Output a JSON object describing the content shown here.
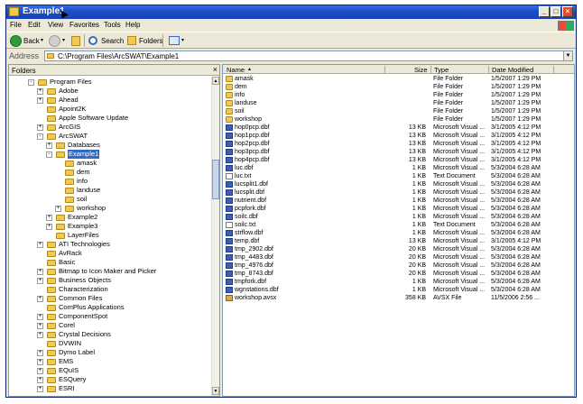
{
  "window": {
    "title": "Example1"
  },
  "menu": [
    "File",
    "Edit",
    "View",
    "Favorites",
    "Tools",
    "Help"
  ],
  "toolbar": {
    "back": "Back",
    "search": "Search",
    "folders": "Folders"
  },
  "address": {
    "label": "Address",
    "value": "C:\\Program Files\\ArcSWAT\\Example1"
  },
  "folders_pane": {
    "title": "Folders"
  },
  "tree": [
    {
      "label": "Program Files",
      "indent": 0,
      "toggle": "-"
    },
    {
      "label": "Adobe",
      "indent": 1,
      "toggle": "+"
    },
    {
      "label": "Ahead",
      "indent": 1,
      "toggle": "+"
    },
    {
      "label": "Apoint2K",
      "indent": 1,
      "toggle": ""
    },
    {
      "label": "Apple Software Update",
      "indent": 1,
      "toggle": ""
    },
    {
      "label": "ArcGIS",
      "indent": 1,
      "toggle": "+"
    },
    {
      "label": "ArcSWAT",
      "indent": 1,
      "toggle": "-"
    },
    {
      "label": "Databases",
      "indent": 2,
      "toggle": "+"
    },
    {
      "label": "Example1",
      "indent": 2,
      "toggle": "-",
      "selected": true
    },
    {
      "label": "amask",
      "indent": 3,
      "toggle": ""
    },
    {
      "label": "dem",
      "indent": 3,
      "toggle": ""
    },
    {
      "label": "info",
      "indent": 3,
      "toggle": ""
    },
    {
      "label": "landuse",
      "indent": 3,
      "toggle": ""
    },
    {
      "label": "soil",
      "indent": 3,
      "toggle": ""
    },
    {
      "label": "workshop",
      "indent": 3,
      "toggle": "+"
    },
    {
      "label": "Example2",
      "indent": 2,
      "toggle": "+"
    },
    {
      "label": "Example3",
      "indent": 2,
      "toggle": "+"
    },
    {
      "label": "LayerFiles",
      "indent": 2,
      "toggle": ""
    },
    {
      "label": "ATI Technologies",
      "indent": 1,
      "toggle": "+"
    },
    {
      "label": "AvRack",
      "indent": 1,
      "toggle": ""
    },
    {
      "label": "Basic",
      "indent": 1,
      "toggle": ""
    },
    {
      "label": "Bitmap to Icon Maker and Picker",
      "indent": 1,
      "toggle": "+"
    },
    {
      "label": "Business Objects",
      "indent": 1,
      "toggle": "+"
    },
    {
      "label": "Characterization",
      "indent": 1,
      "toggle": ""
    },
    {
      "label": "Common Files",
      "indent": 1,
      "toggle": "+"
    },
    {
      "label": "ComPlus Applications",
      "indent": 1,
      "toggle": ""
    },
    {
      "label": "ComponentSpot",
      "indent": 1,
      "toggle": "+"
    },
    {
      "label": "Corel",
      "indent": 1,
      "toggle": "+"
    },
    {
      "label": "Crystal Decisions",
      "indent": 1,
      "toggle": "+"
    },
    {
      "label": "DVWIN",
      "indent": 1,
      "toggle": ""
    },
    {
      "label": "Dymo Label",
      "indent": 1,
      "toggle": "+"
    },
    {
      "label": "EMS",
      "indent": 1,
      "toggle": "+"
    },
    {
      "label": "EQuIS",
      "indent": 1,
      "toggle": "+"
    },
    {
      "label": "ESQuery",
      "indent": 1,
      "toggle": "+"
    },
    {
      "label": "ESRI",
      "indent": 1,
      "toggle": "+"
    }
  ],
  "columns": {
    "name": "Name",
    "size": "Size",
    "type": "Type",
    "date": "Date Modified"
  },
  "files": [
    {
      "name": "amask",
      "size": "",
      "type": "File Folder",
      "date": "1/5/2007 1:29 PM",
      "icon": "folder"
    },
    {
      "name": "dem",
      "size": "",
      "type": "File Folder",
      "date": "1/5/2007 1:29 PM",
      "icon": "folder"
    },
    {
      "name": "info",
      "size": "",
      "type": "File Folder",
      "date": "1/5/2007 1:29 PM",
      "icon": "folder"
    },
    {
      "name": "landuse",
      "size": "",
      "type": "File Folder",
      "date": "1/5/2007 1:29 PM",
      "icon": "folder"
    },
    {
      "name": "soil",
      "size": "",
      "type": "File Folder",
      "date": "1/5/2007 1:29 PM",
      "icon": "folder"
    },
    {
      "name": "workshop",
      "size": "",
      "type": "File Folder",
      "date": "1/5/2007 1:29 PM",
      "icon": "folder"
    },
    {
      "name": "hop0pcp.dbf",
      "size": "13 KB",
      "type": "Microsoft Visual ...",
      "date": "3/1/2005 4:12 PM",
      "icon": "dbf"
    },
    {
      "name": "hop1pcp.dbf",
      "size": "13 KB",
      "type": "Microsoft Visual ...",
      "date": "3/1/2005 4:12 PM",
      "icon": "dbf"
    },
    {
      "name": "hop2pcp.dbf",
      "size": "13 KB",
      "type": "Microsoft Visual ...",
      "date": "3/1/2005 4:12 PM",
      "icon": "dbf"
    },
    {
      "name": "hop3pcp.dbf",
      "size": "13 KB",
      "type": "Microsoft Visual ...",
      "date": "3/1/2005 4:12 PM",
      "icon": "dbf"
    },
    {
      "name": "hop4pcp.dbf",
      "size": "13 KB",
      "type": "Microsoft Visual ...",
      "date": "3/1/2005 4:12 PM",
      "icon": "dbf"
    },
    {
      "name": "luc.dbf",
      "size": "1 KB",
      "type": "Microsoft Visual ...",
      "date": "5/3/2004 6:28 AM",
      "icon": "dbf"
    },
    {
      "name": "luc.txt",
      "size": "1 KB",
      "type": "Text Document",
      "date": "5/3/2004 6:28 AM",
      "icon": "txt"
    },
    {
      "name": "lucsplit1.dbf",
      "size": "1 KB",
      "type": "Microsoft Visual ...",
      "date": "5/3/2004 6:28 AM",
      "icon": "dbf"
    },
    {
      "name": "lucsplit.dbf",
      "size": "1 KB",
      "type": "Microsoft Visual ...",
      "date": "5/3/2004 6:28 AM",
      "icon": "dbf"
    },
    {
      "name": "nutrient.dbf",
      "size": "1 KB",
      "type": "Microsoft Visual ...",
      "date": "5/3/2004 6:28 AM",
      "icon": "dbf"
    },
    {
      "name": "pcpfork.dbf",
      "size": "1 KB",
      "type": "Microsoft Visual ...",
      "date": "5/3/2004 6:28 AM",
      "icon": "dbf"
    },
    {
      "name": "soilc.dbf",
      "size": "1 KB",
      "type": "Microsoft Visual ...",
      "date": "5/3/2004 6:28 AM",
      "icon": "dbf"
    },
    {
      "name": "soilc.txt",
      "size": "1 KB",
      "type": "Text Document",
      "date": "5/3/2004 6:28 AM",
      "icon": "txt"
    },
    {
      "name": "strflow.dbf",
      "size": "1 KB",
      "type": "Microsoft Visual ...",
      "date": "5/3/2004 6:28 AM",
      "icon": "dbf"
    },
    {
      "name": "temp.dbf",
      "size": "13 KB",
      "type": "Microsoft Visual ...",
      "date": "3/1/2005 4:12 PM",
      "icon": "dbf"
    },
    {
      "name": "tmp_2902.dbf",
      "size": "20 KB",
      "type": "Microsoft Visual ...",
      "date": "5/3/2004 6:28 AM",
      "icon": "dbf"
    },
    {
      "name": "tmp_4483.dbf",
      "size": "20 KB",
      "type": "Microsoft Visual ...",
      "date": "5/3/2004 6:28 AM",
      "icon": "dbf"
    },
    {
      "name": "tmp_4976.dbf",
      "size": "20 KB",
      "type": "Microsoft Visual ...",
      "date": "5/3/2004 6:28 AM",
      "icon": "dbf"
    },
    {
      "name": "tmp_8743.dbf",
      "size": "20 KB",
      "type": "Microsoft Visual ...",
      "date": "5/3/2004 6:28 AM",
      "icon": "dbf"
    },
    {
      "name": "tmpfork.dbf",
      "size": "1 KB",
      "type": "Microsoft Visual ...",
      "date": "5/3/2004 6:28 AM",
      "icon": "dbf"
    },
    {
      "name": "wgnstations.dbf",
      "size": "1 KB",
      "type": "Microsoft Visual ...",
      "date": "5/3/2004 6:28 AM",
      "icon": "dbf"
    },
    {
      "name": "workshop.avsx",
      "size": "358 KB",
      "type": "AVSX File",
      "date": "11/5/2006 2:56 ...",
      "icon": "avsx"
    }
  ]
}
